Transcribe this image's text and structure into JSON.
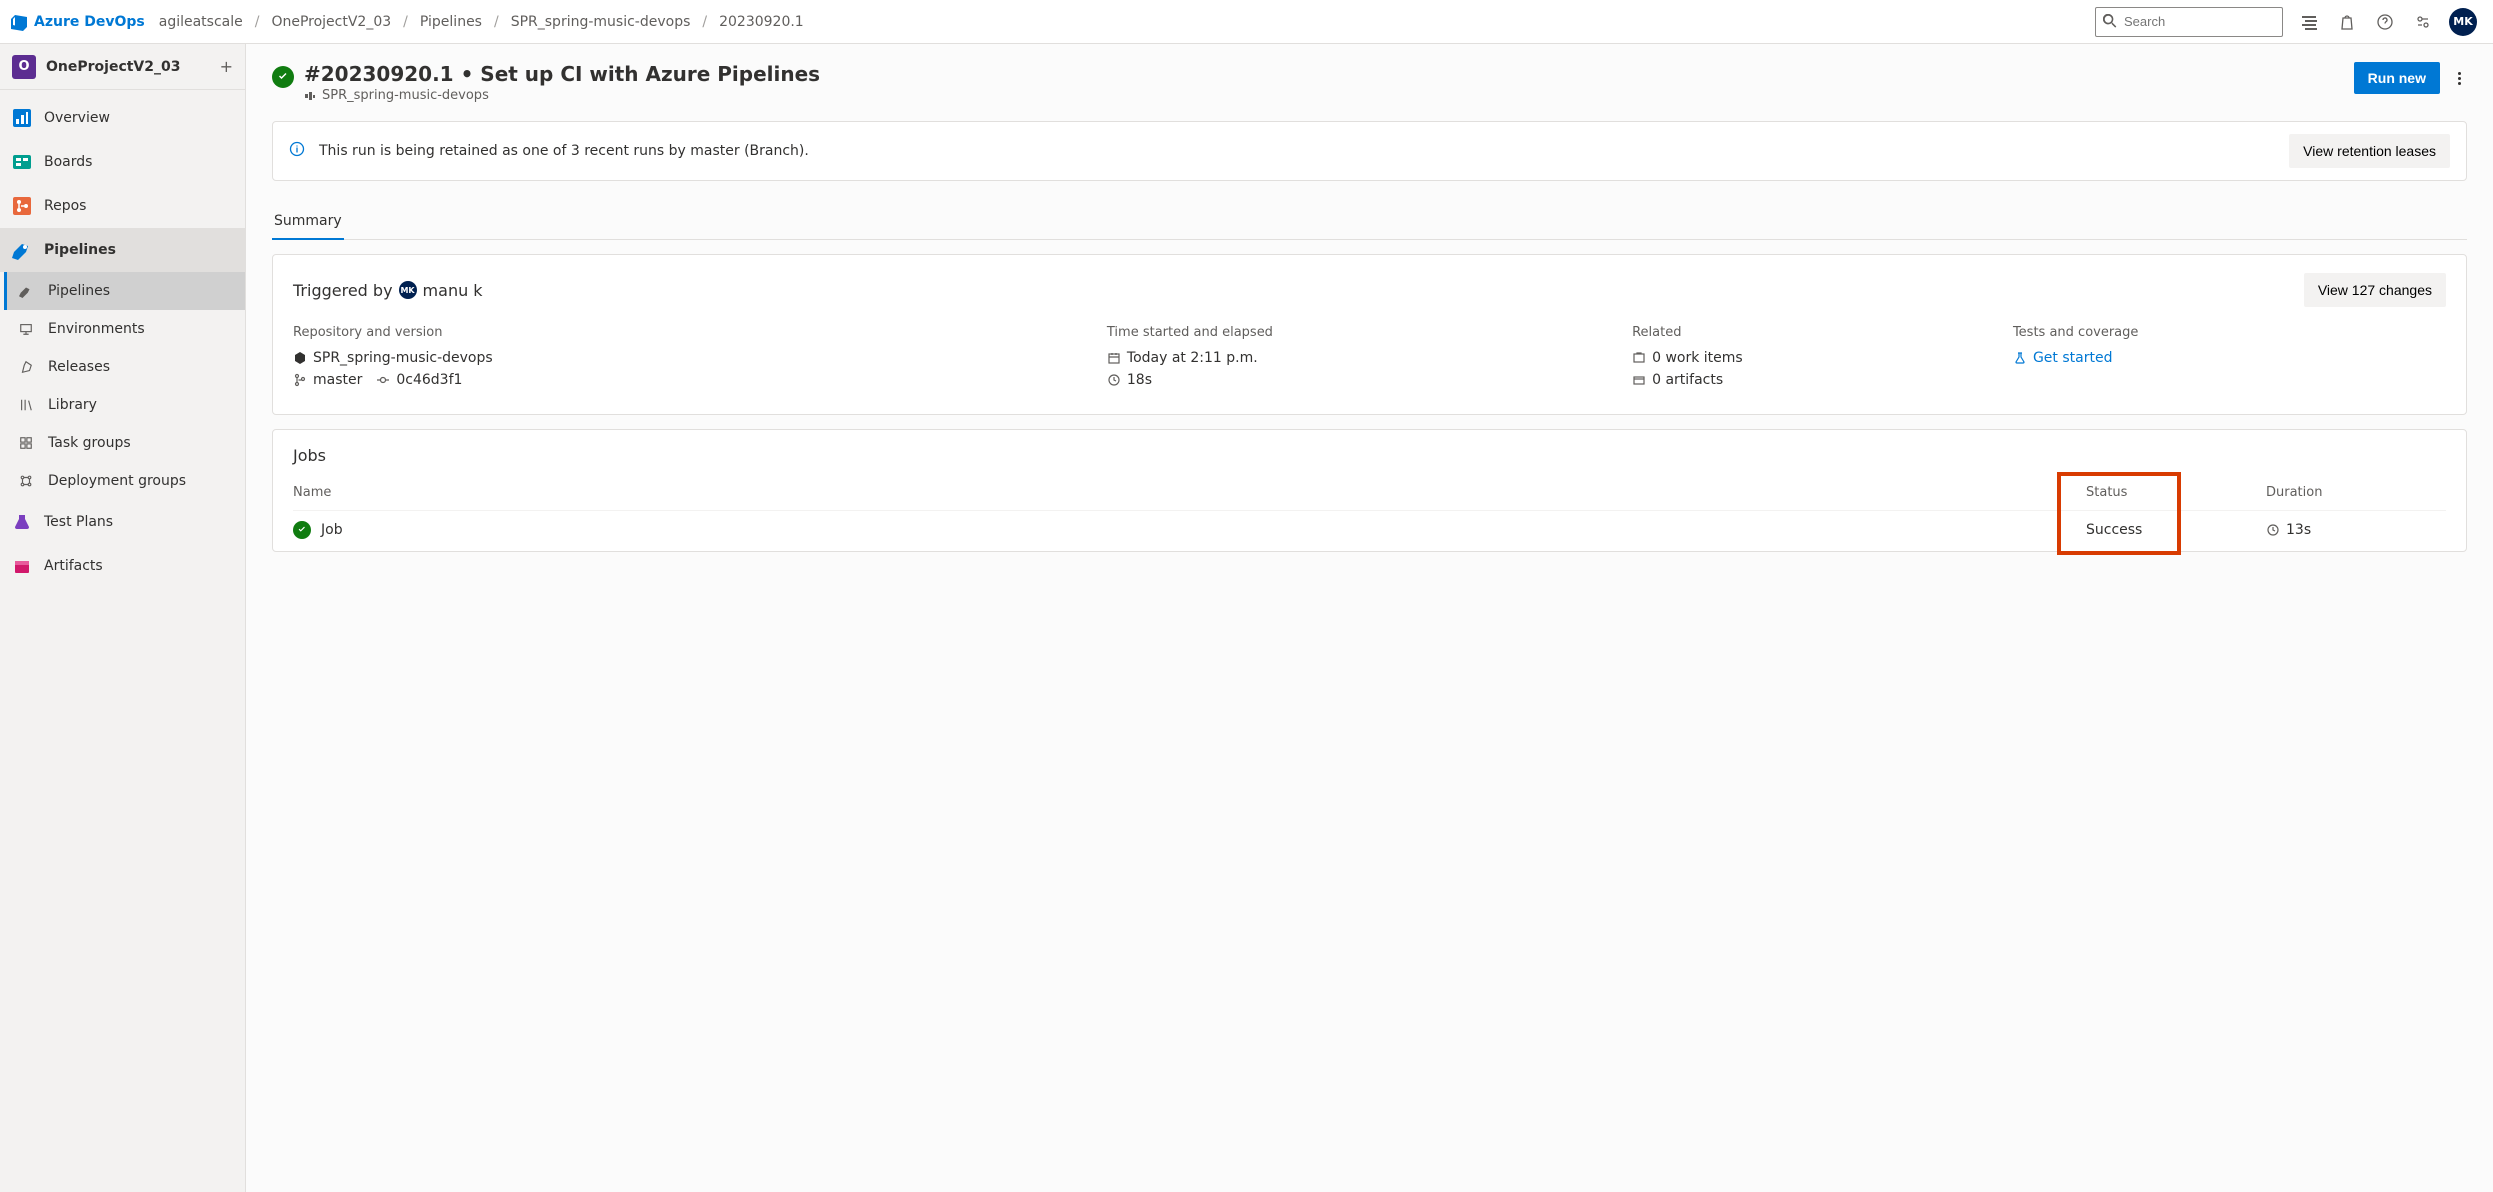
{
  "brand": "Azure DevOps",
  "breadcrumbs": [
    "agileatscale",
    "OneProjectV2_03",
    "Pipelines",
    "SPR_spring-music-devops",
    "20230920.1"
  ],
  "search": {
    "placeholder": "Search"
  },
  "avatar_initials": "MK",
  "project": {
    "initial": "O",
    "name": "OneProjectV2_03"
  },
  "nav": {
    "overview": "Overview",
    "boards": "Boards",
    "repos": "Repos",
    "pipelines": "Pipelines",
    "sub": {
      "pipelines": "Pipelines",
      "environments": "Environments",
      "releases": "Releases",
      "library": "Library",
      "task_groups": "Task groups",
      "deployment_groups": "Deployment groups"
    },
    "test_plans": "Test Plans",
    "artifacts": "Artifacts"
  },
  "page": {
    "title": "#20230920.1 • Set up CI with Azure Pipelines",
    "pipeline_name": "SPR_spring-music-devops",
    "run_new": "Run new"
  },
  "banner": {
    "text": "This run is being retained as one of 3 recent runs by master (Branch).",
    "action": "View retention leases"
  },
  "tabs": {
    "summary": "Summary"
  },
  "summary": {
    "triggered_prefix": "Triggered by",
    "triggered_initials": "MK",
    "triggered_by": "manu k",
    "view_changes": "View 127 changes",
    "col1_head": "Repository and version",
    "repo_name": "SPR_spring-music-devops",
    "branch": "master",
    "commit": "0c46d3f1",
    "col2_head": "Time started and elapsed",
    "started": "Today at 2:11 p.m.",
    "elapsed": "18s",
    "col3_head": "Related",
    "work_items": "0 work items",
    "artifacts": "0 artifacts",
    "col4_head": "Tests and coverage",
    "get_started": "Get started"
  },
  "jobs": {
    "heading": "Jobs",
    "name_head": "Name",
    "status_head": "Status",
    "duration_head": "Duration",
    "rows": [
      {
        "name": "Job",
        "status": "Success",
        "duration": "13s"
      }
    ]
  }
}
